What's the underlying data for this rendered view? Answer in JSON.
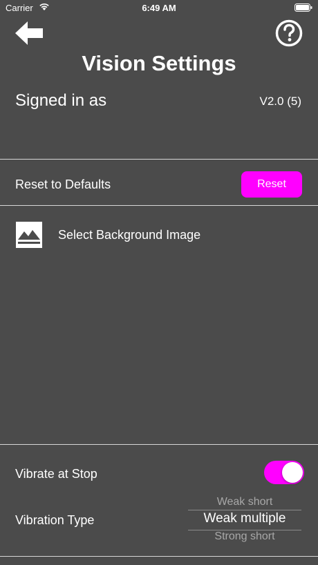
{
  "status_bar": {
    "carrier": "Carrier",
    "time": "6:49 AM"
  },
  "header": {
    "title": "Vision Settings",
    "back_icon": "arrow-left-icon",
    "help_icon": "question-circle-icon"
  },
  "account": {
    "signed_in_label": "Signed in as",
    "version": "V2.0 (5)"
  },
  "reset": {
    "label": "Reset to Defaults",
    "button_label": "Reset"
  },
  "background": {
    "icon": "image-icon",
    "label": "Select Background Image"
  },
  "vibrate": {
    "label": "Vibrate at Stop",
    "enabled": true
  },
  "vibration_type": {
    "label": "Vibration Type",
    "options_visible": [
      "Weak short",
      "Weak multiple",
      "Strong short"
    ],
    "selected": "Weak multiple"
  },
  "colors": {
    "background": "#4b4b4b",
    "accent": "#ff00ff",
    "text": "#ffffff",
    "divider": "#d8d8d8"
  }
}
